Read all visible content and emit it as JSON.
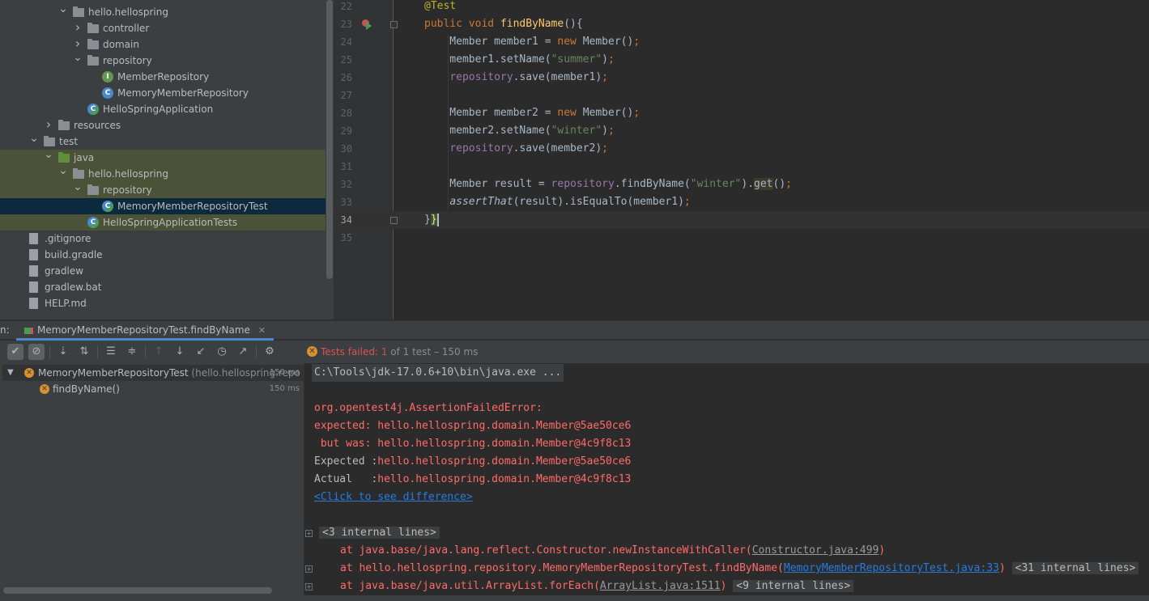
{
  "project_tree": [
    {
      "label": "hello.hellospring",
      "indent": 1,
      "arrow": "open",
      "icon": "package-icon",
      "state": ""
    },
    {
      "label": "controller",
      "indent": 2,
      "arrow": "closed",
      "icon": "package-icon",
      "state": ""
    },
    {
      "label": "domain",
      "indent": 2,
      "arrow": "closed",
      "icon": "package-icon",
      "state": ""
    },
    {
      "label": "repository",
      "indent": 2,
      "arrow": "open",
      "icon": "package-icon",
      "state": ""
    },
    {
      "label": "MemberRepository",
      "indent": 3,
      "arrow": "none",
      "icon": "interface-icon",
      "state": ""
    },
    {
      "label": "MemoryMemberRepository",
      "indent": 3,
      "arrow": "none",
      "icon": "class-icon",
      "state": ""
    },
    {
      "label": "HelloSpringApplication",
      "indent": 2,
      "arrow": "none",
      "icon": "spring-class-icon",
      "state": ""
    },
    {
      "label": "resources",
      "indent": 0,
      "arrow": "closed",
      "icon": "folder-icon",
      "state": ""
    },
    {
      "label": "test",
      "indent": -1,
      "arrow": "open",
      "icon": "folder-icon",
      "state": ""
    },
    {
      "label": "java",
      "indent": 0,
      "arrow": "open",
      "icon": "folder-green-icon",
      "state": "hl"
    },
    {
      "label": "hello.hellospring",
      "indent": 1,
      "arrow": "open",
      "icon": "package-icon",
      "state": "hl"
    },
    {
      "label": "repository",
      "indent": 2,
      "arrow": "open",
      "icon": "package-icon",
      "state": "hl"
    },
    {
      "label": "MemoryMemberRepositoryTest",
      "indent": 3,
      "arrow": "none",
      "icon": "spring-class-icon",
      "state": "sel"
    },
    {
      "label": "HelloSpringApplicationTests",
      "indent": 2,
      "arrow": "none",
      "icon": "spring-class-icon",
      "state": "hl"
    },
    {
      "label": ".gitignore",
      "indent": -2,
      "arrow": "none",
      "icon": "file-icon",
      "state": ""
    },
    {
      "label": "build.gradle",
      "indent": -2,
      "arrow": "none",
      "icon": "gradle-icon",
      "state": ""
    },
    {
      "label": "gradlew",
      "indent": -2,
      "arrow": "none",
      "icon": "file-icon",
      "state": ""
    },
    {
      "label": "gradlew.bat",
      "indent": -2,
      "arrow": "none",
      "icon": "file-icon",
      "state": ""
    },
    {
      "label": "HELP.md",
      "indent": -2,
      "arrow": "none",
      "icon": "markdown-icon",
      "state": ""
    }
  ],
  "editor": {
    "lines": [
      {
        "num": "22",
        "html": "<span class=\"ann\">@Test</span>"
      },
      {
        "num": "23",
        "html": "<span class=\"kw\">public void </span><span class=\"fn\">findByName</span>(){"
      },
      {
        "num": "24",
        "html": "    Member member1 = <span class=\"kw\">new </span>Member()<span class=\"kw\">;</span>"
      },
      {
        "num": "25",
        "html": "    member1.setName(<span class=\"str\">\"summer\"</span>)<span class=\"kw\">;</span>"
      },
      {
        "num": "26",
        "html": "    <span class=\"fld\">repository</span>.save(member1)<span class=\"kw\">;</span>"
      },
      {
        "num": "27",
        "html": ""
      },
      {
        "num": "28",
        "html": "    Member member2 = <span class=\"kw\">new </span>Member()<span class=\"kw\">;</span>"
      },
      {
        "num": "29",
        "html": "    member2.setName(<span class=\"str\">\"winter\"</span>)<span class=\"kw\">;</span>"
      },
      {
        "num": "30",
        "html": "    <span class=\"fld\">repository</span>.save(member2)<span class=\"kw\">;</span>"
      },
      {
        "num": "31",
        "html": ""
      },
      {
        "num": "32",
        "html": "    Member result = <span class=\"fld\">repository</span>.findByName(<span class=\"str\">\"winter\"</span>).<span class=\"getm\">get</span>()<span class=\"kw\">;</span>"
      },
      {
        "num": "33",
        "html": "    <span class=\"ital\">assertThat</span>(result).isEqualTo(member1)<span class=\"kw\">;</span>"
      },
      {
        "num": "34",
        "html": "}<span class=\"brace-hl\">}</span><span class=\"caret\"></span>"
      },
      {
        "num": "35",
        "html": ""
      }
    ]
  },
  "run_panel": {
    "prefix": "n:",
    "tab_title": "MemoryMemberRepositoryTest.findByName",
    "tab_close": "✕",
    "status": {
      "failed_label": "Tests failed: ",
      "failed_count": "1",
      "rest": " of 1 test – 150 ms"
    },
    "tests": [
      {
        "name": "MemoryMemberRepositoryTest",
        "pkg": " (hello.hellospring.repo",
        "time": "150 ms"
      },
      {
        "name": "findByName()",
        "pkg": "",
        "time": "150 ms"
      }
    ]
  },
  "console": {
    "cmd": "C:\\Tools\\jdk-17.0.6+10\\bin\\java.exe ...",
    "error_class": "org.opentest4j.AssertionFailedError:",
    "expected_line": "expected: hello.hellospring.domain.Member@5ae50ce6",
    "butwas_line": " but was: hello.hellospring.domain.Member@4c9f8c13",
    "expected_label": "Expected :",
    "expected_value": "hello.hellospring.domain.Member@5ae50ce6",
    "actual_label": "Actual   :",
    "actual_value": "hello.hellospring.domain.Member@4c9f8c13",
    "diff_link": "<Click to see difference>",
    "internal1": "<3 internal lines>",
    "trace1_prefix": "at java.base/java.lang.reflect.Constructor.newInstanceWithCaller(",
    "trace1_link": "Constructor.java:499",
    "trace1_suffix": ")",
    "trace2_prefix": "at hello.hellospring.repository.MemoryMemberRepositoryTest.findByName(",
    "trace2_link": "MemoryMemberRepositoryTest.java:33",
    "trace2_suffix": ")",
    "internal2": "<31 internal lines>",
    "trace3_prefix": "at java.base/java.util.ArrayList.forEach(",
    "trace3_link": "ArrayList.java:1511",
    "trace3_suffix": ")",
    "internal3": "<9 internal lines>"
  }
}
